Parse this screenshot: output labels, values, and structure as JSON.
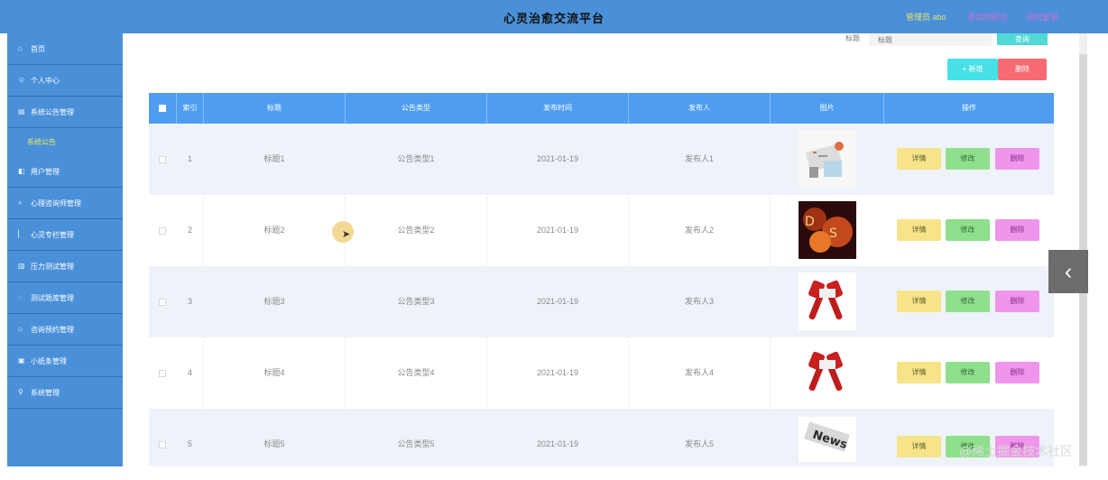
{
  "header": {
    "title": "心灵治愈交流平台",
    "admin": "管理员 abo",
    "link1": "退出到前台",
    "link2": "退出登录"
  },
  "sidebar": {
    "items": [
      {
        "label": "首页",
        "icon": "home-icon"
      },
      {
        "label": "个人中心",
        "icon": "user-icon"
      },
      {
        "label": "系统公告管理",
        "icon": "notice-icon"
      },
      {
        "label": "用户管理",
        "icon": "users-icon"
      },
      {
        "label": "心理咨询师管理",
        "icon": "consult-icon"
      },
      {
        "label": "心灵专栏管理",
        "icon": "column-icon"
      },
      {
        "label": "压力测试管理",
        "icon": "test-icon"
      },
      {
        "label": "测试题库管理",
        "icon": "quiz-icon"
      },
      {
        "label": "咨询预约管理",
        "icon": "calendar-icon"
      },
      {
        "label": "小纸条管理",
        "icon": "note-icon"
      },
      {
        "label": "系统管理",
        "icon": "settings-icon"
      }
    ],
    "sub": "系统公告"
  },
  "search": {
    "label": "标题",
    "placeholder": "标题",
    "button": "查询"
  },
  "actions": {
    "add": "+ 新增",
    "delete": "删除"
  },
  "table": {
    "headers": [
      "",
      "索引",
      "标题",
      "公告类型",
      "发布时间",
      "发布人",
      "图片",
      "操作"
    ],
    "rows": [
      {
        "index": "1",
        "title": "标题1",
        "type": "公告类型1",
        "time": "2021-01-19",
        "publisher": "发布人1",
        "image": "office-thumbnail"
      },
      {
        "index": "2",
        "title": "标题2",
        "type": "公告类型2",
        "time": "2021-01-19",
        "publisher": "发布人2",
        "image": "fire-letters-thumbnail"
      },
      {
        "index": "3",
        "title": "标题3",
        "type": "公告类型3",
        "time": "2021-01-19",
        "publisher": "发布人3",
        "image": "microphone-thumbnail"
      },
      {
        "index": "4",
        "title": "标题4",
        "type": "公告类型4",
        "time": "2021-01-19",
        "publisher": "发布人4",
        "image": "microphone-thumbnail"
      },
      {
        "index": "5",
        "title": "标题5",
        "type": "公告类型5",
        "time": "2021-01-19",
        "publisher": "发布人5",
        "image": "news-thumbnail"
      }
    ],
    "op_detail": "详情",
    "op_edit": "修改",
    "op_delete": "删除"
  },
  "watermark": "@稀土掘金技术社区"
}
